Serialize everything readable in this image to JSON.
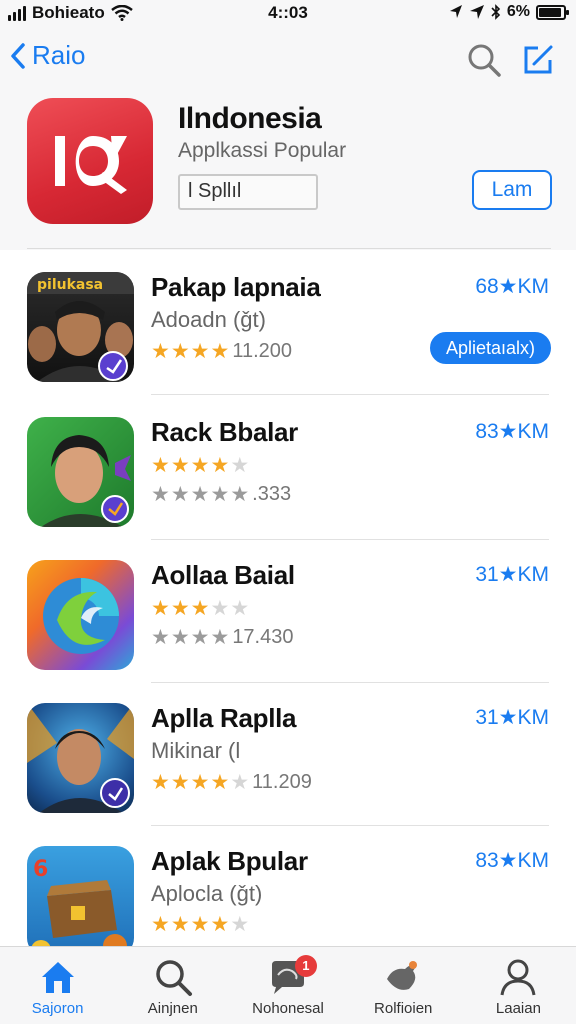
{
  "status_bar": {
    "carrier": "Bohieato",
    "time": "4::03",
    "battery": "6%",
    "battery_level": 0.9
  },
  "nav": {
    "back_label": "Raio"
  },
  "header": {
    "title": "Ilndonesia",
    "subtitle": "Applkassi Popular",
    "search_text": "l Spllıl",
    "button_label": "Lam"
  },
  "apps": [
    {
      "title": "Pakap lapnaia",
      "subtitle": "Adoadn (ǧt)",
      "meta": "68★KM",
      "rating": 4,
      "rating_count": "11.200",
      "action_label": "Aplietaıalx)"
    },
    {
      "title": "Rack Bbalar",
      "meta": "83★KM",
      "rating": 4,
      "rating_secondary": 5,
      "rating_count": ".333"
    },
    {
      "title": "Aollaa Baial",
      "meta": "31★KM",
      "rating": 3,
      "rating_secondary": 4,
      "rating_count": "17.430"
    },
    {
      "title": "Aplla Raplla",
      "subtitle": "Mikinar (l",
      "meta": "31★KM",
      "rating": 4,
      "rating_count": "11.209"
    },
    {
      "title": "Aplak Bpular",
      "subtitle": "Aplocla (ǧt)",
      "meta": "83★KM",
      "rating": 4
    }
  ],
  "tabs": [
    {
      "label": "Sajoron",
      "icon": "home-icon",
      "active": true
    },
    {
      "label": "Ainjnen",
      "icon": "search-icon"
    },
    {
      "label": "Nohonesal",
      "icon": "chat-icon",
      "badge": "1"
    },
    {
      "label": "Rolfioien",
      "icon": "bird-icon"
    },
    {
      "label": "Laaian",
      "icon": "person-icon"
    }
  ],
  "colors": {
    "accent": "#1a7cf0",
    "star": "#f5a623",
    "main_icon": "#d72834"
  }
}
